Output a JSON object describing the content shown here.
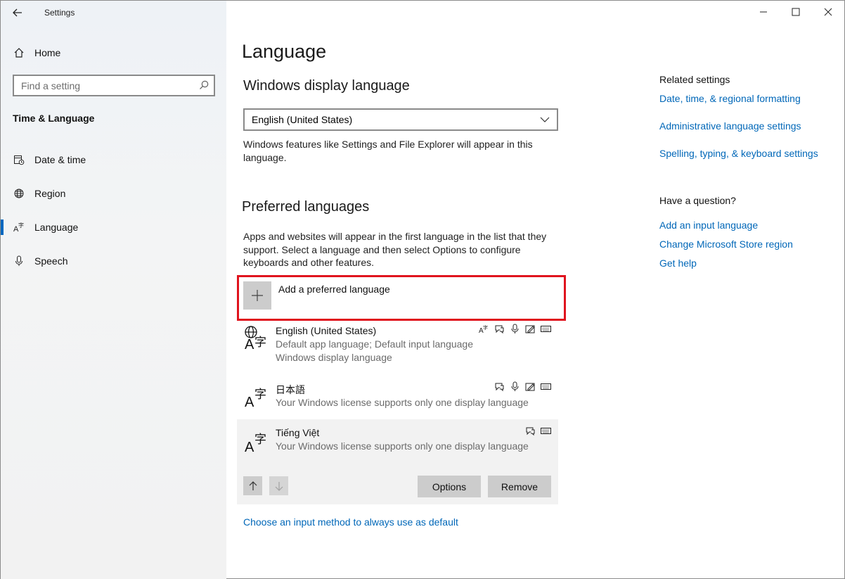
{
  "window": {
    "title": "Settings",
    "controls": [
      "minimize",
      "maximize",
      "close"
    ]
  },
  "sidebar": {
    "home_label": "Home",
    "search_placeholder": "Find a setting",
    "section": "Time & Language",
    "items": [
      {
        "label": "Date & time",
        "icon": "calendar-clock-icon"
      },
      {
        "label": "Region",
        "icon": "globe-icon"
      },
      {
        "label": "Language",
        "icon": "language-icon",
        "active": true
      },
      {
        "label": "Speech",
        "icon": "microphone-icon"
      }
    ]
  },
  "main": {
    "title": "Language",
    "display_language": {
      "heading": "Windows display language",
      "selected": "English (United States)",
      "description": "Windows features like Settings and File Explorer will appear in this language."
    },
    "preferred": {
      "heading": "Preferred languages",
      "description": "Apps and websites will appear in the first language in the list that they support. Select a language and then select Options to configure keyboards and other features.",
      "add_label": "Add a preferred language",
      "languages": [
        {
          "name": "English (United States)",
          "sub1": "Default app language; Default input language",
          "sub2": "Windows display language",
          "features": [
            "display-language-icon",
            "speech-bubble-icon",
            "microphone-icon",
            "handwriting-icon",
            "keyboard-icon"
          ]
        },
        {
          "name": "日本語",
          "sub1": "Your Windows license supports only one display language",
          "features": [
            "speech-bubble-icon",
            "microphone-icon",
            "handwriting-icon",
            "keyboard-icon"
          ]
        },
        {
          "name": "Tiếng Việt",
          "sub1": "Your Windows license supports only one display language",
          "features": [
            "speech-bubble-icon",
            "keyboard-icon"
          ],
          "selected": true
        }
      ],
      "options_label": "Options",
      "remove_label": "Remove"
    },
    "input_method_link": "Choose an input method to always use as default"
  },
  "related": {
    "heading": "Related settings",
    "links": [
      "Date, time, & regional formatting",
      "Administrative language settings",
      "Spelling, typing, & keyboard settings"
    ],
    "question_heading": "Have a question?",
    "question_links": [
      "Add an input language",
      "Change Microsoft Store region",
      "Get help"
    ]
  },
  "colors": {
    "accent": "#0067c0",
    "link": "#0067b8",
    "highlight_border": "#e0141e"
  }
}
